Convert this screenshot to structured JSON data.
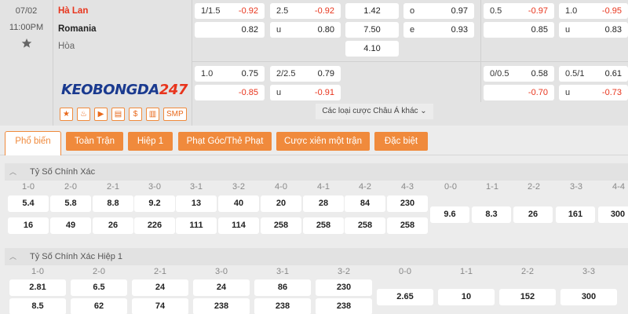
{
  "match": {
    "date": "07/02",
    "time": "11:00PM",
    "home": "Hà Lan",
    "away": "Romania",
    "draw": "Hòa",
    "logo_text_a": "KEOBONGDA",
    "logo_text_b": "247",
    "icons": [
      "$",
      "SMP"
    ],
    "more_odds_label": "Các loại cược Châu Á khác",
    "odds_row1": {
      "hdp_line": "1/1.5",
      "hdp_home": "-0.92",
      "hdp_away": "0.82",
      "ou_line": "2.5",
      "ou_over": "-0.92",
      "ou_under_label": "u",
      "ou_under": "0.80",
      "x12_home": "1.42",
      "x12_away": "7.50",
      "x12_draw": "4.10",
      "oe_o_label": "o",
      "oe_o": "0.97",
      "oe_e_label": "e",
      "oe_e": "0.93",
      "h1_hdp_line": "0.5",
      "h1_hdp_home": "-0.97",
      "h1_hdp_away": "0.85",
      "h1_ou_line": "1.0",
      "h1_ou_over": "-0.95",
      "h1_ou_under_label": "u",
      "h1_ou_under": "0.83"
    },
    "odds_row2": {
      "hdp_line": "1.0",
      "hdp_home": "0.75",
      "hdp_away": "-0.85",
      "ou_line": "2/2.5",
      "ou_over": "0.79",
      "ou_under_label": "u",
      "ou_under": "-0.91",
      "h1_hdp_line": "0/0.5",
      "h1_hdp_home": "0.58",
      "h1_hdp_away": "-0.70",
      "h1_ou_line": "0.5/1",
      "h1_ou_over": "0.61",
      "h1_ou_under_label": "u",
      "h1_ou_under": "-0.73"
    }
  },
  "tabs": [
    "Phổ biến",
    "Toàn Trận",
    "Hiệp 1",
    "Phạt Góc/Thẻ Phạt",
    "Cược xiên một trận",
    "Đặc biệt"
  ],
  "section1": {
    "title": "Tỷ Số Chính Xác",
    "labels": [
      "1-0",
      "2-0",
      "2-1",
      "3-0",
      "3-1",
      "3-2",
      "4-0",
      "4-1",
      "4-2",
      "4-3",
      "0-0",
      "1-1",
      "2-2",
      "3-3",
      "4-4"
    ],
    "row_a": [
      "5.4",
      "5.8",
      "8.8",
      "9.2",
      "13",
      "40",
      "20",
      "28",
      "84",
      "230"
    ],
    "row_b": [
      "16",
      "49",
      "26",
      "226",
      "111",
      "114",
      "258",
      "258",
      "258",
      "258"
    ],
    "draws": [
      "9.6",
      "8.3",
      "26",
      "161",
      "300"
    ]
  },
  "section2": {
    "title": "Tỷ Số Chính Xác Hiệp 1",
    "labels": [
      "1-0",
      "2-0",
      "2-1",
      "3-0",
      "3-1",
      "3-2",
      "0-0",
      "1-1",
      "2-2",
      "3-3"
    ],
    "row_a": [
      "2.81",
      "6.5",
      "24",
      "24",
      "86",
      "230"
    ],
    "row_b": [
      "8.5",
      "62",
      "74",
      "238",
      "238",
      "238"
    ],
    "draws": [
      "2.65",
      "10",
      "152",
      "300"
    ]
  }
}
